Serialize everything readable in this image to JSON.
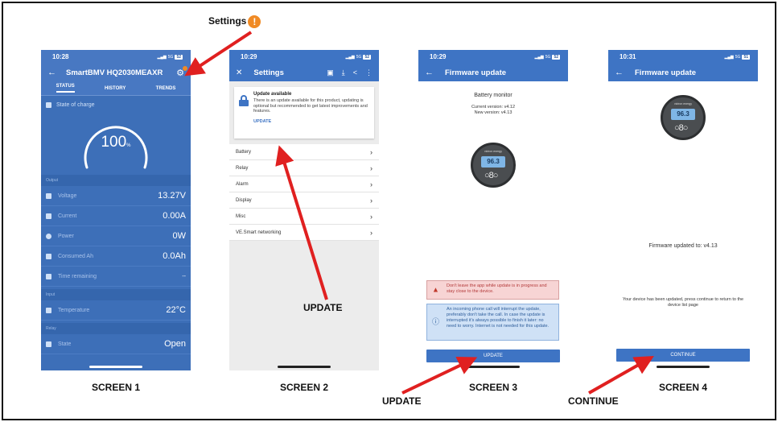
{
  "screen1": {
    "time": "10:28",
    "network": "5G",
    "battery": "52",
    "title": "SmartBMV HQ2030MEAXR",
    "tabs": [
      "STATUS",
      "HISTORY",
      "TRENDS"
    ],
    "soc_label": "State of charge",
    "soc_value": "100",
    "soc_unit": "%",
    "section_output": "Output",
    "rows": [
      {
        "label": "Voltage",
        "value": "13.27V"
      },
      {
        "label": "Current",
        "value": "0.00A"
      },
      {
        "label": "Power",
        "value": "0W"
      },
      {
        "label": "Consumed Ah",
        "value": "0.0Ah"
      },
      {
        "label": "Time remaining",
        "value": "--"
      }
    ],
    "section_input": "Input",
    "temp_label": "Temperature",
    "temp_value": "22°C",
    "section_relay": "Relay",
    "state_label": "State",
    "state_value": "Open",
    "caption": "SCREEN 1"
  },
  "screen2": {
    "time": "10:29",
    "network": "5G",
    "battery": "52",
    "title": "Settings",
    "card_title": "Update available",
    "card_text": "There is an update available for this product, updating is optional but recommended to get latest improvements and features.",
    "card_action": "UPDATE",
    "items": [
      "Battery",
      "Relay",
      "Alarm",
      "Display",
      "Misc",
      "VE.Smart networking"
    ],
    "caption": "SCREEN 2"
  },
  "screen3": {
    "time": "10:29",
    "network": "5G",
    "battery": "52",
    "title": "Firmware update",
    "device_name": "Battery monitor",
    "current_version": "Current version: v4.12",
    "new_version": "New version: v4.13",
    "lcd": "96.3",
    "brand": "victron energy",
    "warn_red": "Don't leave the app while update is in progress and stay close to the device.",
    "warn_blue": "An incoming phone call will interrupt the update, preferably don't take the call. In case the update is interrupted it's always possible to finish it later: no need to worry. Internet is not needed for this update.",
    "button": "UPDATE",
    "caption": "SCREEN 3"
  },
  "screen4": {
    "time": "10:31",
    "network": "5G",
    "battery": "51",
    "title": "Firmware update",
    "lcd": "96.3",
    "brand": "victron energy",
    "updated_text": "Firmware updated to: v4.13",
    "info_text": "Your device has been updated, press continue to return to the device list page",
    "button": "CONTINUE",
    "caption": "SCREEN 4"
  },
  "callouts": {
    "settings": "Settings",
    "settings_badge": "!",
    "update_s2": "UPDATE",
    "update_s3": "UPDATE",
    "continue": "CONTINUE"
  },
  "colors": {
    "app_blue": "#3e74c4",
    "arrow_red": "#e02020",
    "badge_orange": "#f08a24"
  }
}
